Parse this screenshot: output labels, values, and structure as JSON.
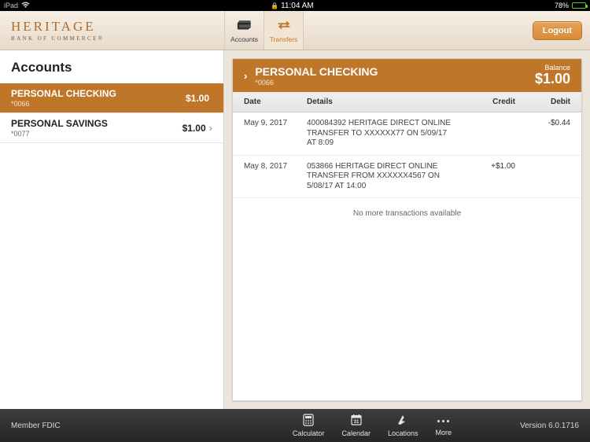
{
  "colors": {
    "brand": "#b16a2b",
    "accent": "#c07629",
    "logout": "#d88c37"
  },
  "status": {
    "device": "iPad",
    "battery": "78%",
    "time": "11:04 AM"
  },
  "brand": {
    "title": "HERITAGE",
    "subtitle": "BANK OF COMMERCE®"
  },
  "nav": {
    "accounts_label": "Accounts",
    "transfers_label": "Transfers",
    "logout_label": "Logout"
  },
  "sidebar": {
    "title": "Accounts",
    "accounts": [
      {
        "name": "PERSONAL CHECKING",
        "number": "*0066",
        "balance": "$1.00",
        "selected": true
      },
      {
        "name": "PERSONAL SAVINGS",
        "number": "*0077",
        "balance": "$1.00",
        "selected": false
      }
    ]
  },
  "detail": {
    "title": "PERSONAL CHECKING",
    "subtitle": "*0066",
    "balance_label": "Balance",
    "balance_value": "$1.00",
    "columns": {
      "date": "Date",
      "details": "Details",
      "credit": "Credit",
      "debit": "Debit"
    },
    "transactions": [
      {
        "date": "May 9, 2017",
        "details": "400084392 HERITAGE DIRECT ONLINE TRANSFER TO XXXXXX77 ON 5/09/17 AT 8:09",
        "credit": "",
        "debit": "-$0.44"
      },
      {
        "date": "May 8, 2017",
        "details": "053866 HERITAGE DIRECT ONLINE TRANSFER FROM XXXXXX4567 ON 5/08/17 AT 14:00",
        "credit": "+$1.00",
        "debit": ""
      }
    ],
    "no_more": "No more transactions available"
  },
  "footer": {
    "left": "Member FDIC",
    "calculator": "Calculator",
    "calendar": "Calendar",
    "locations": "Locations",
    "more": "More",
    "version": "Version 6.0.1716"
  }
}
